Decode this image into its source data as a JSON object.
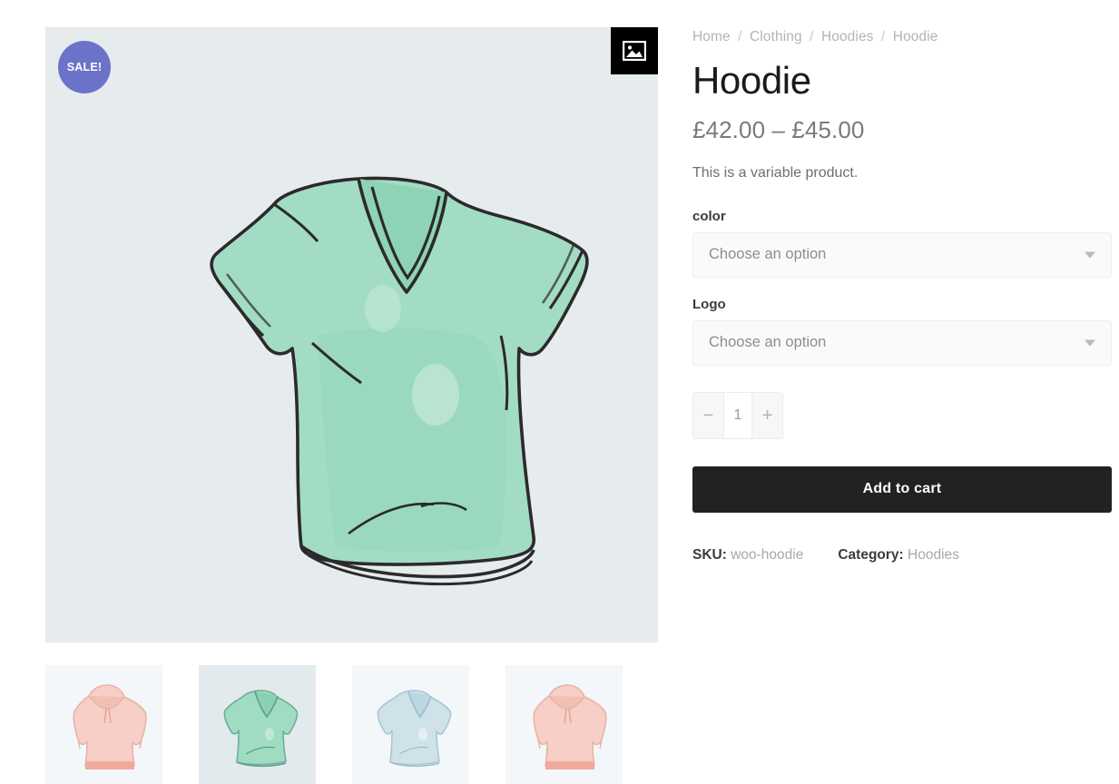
{
  "gallery": {
    "sale_badge": "SALE!",
    "zoom_icon": "image-placeholder-icon",
    "main_image_alt": "Mint green hand-drawn v-neck t-shirt",
    "background_color": "#e6ebee",
    "thumbnails": [
      {
        "alt": "Pink hoodie",
        "garment": "hoodie",
        "color": "#f7cfc6",
        "active": false
      },
      {
        "alt": "Green t-shirt",
        "garment": "tshirt",
        "color": "#9fdcc2",
        "active": true
      },
      {
        "alt": "Blue t-shirt",
        "garment": "tshirt",
        "color": "#cfe2ea",
        "active": false
      },
      {
        "alt": "Pink hoodie",
        "garment": "hoodie",
        "color": "#f7cfc6",
        "active": false
      }
    ]
  },
  "breadcrumb": {
    "separator": "/",
    "items": [
      "Home",
      "Clothing",
      "Hoodies",
      "Hoodie"
    ]
  },
  "product": {
    "title": "Hoodie",
    "price_min": "£42.00",
    "price_range_separator": "–",
    "price_max": "£45.00",
    "price_display": "£42.00 – £45.00",
    "short_description": "This is a variable product."
  },
  "variations": [
    {
      "label": "color",
      "selected": "Choose an option",
      "placeholder": "Choose an option",
      "caret_icon": "chevron-down-icon"
    },
    {
      "label": "Logo",
      "selected": "Choose an option",
      "placeholder": "Choose an option",
      "caret_icon": "chevron-down-icon"
    }
  ],
  "cart": {
    "decrement_label": "−",
    "quantity_value": "1",
    "increment_label": "+",
    "add_to_cart_label": "Add to cart"
  },
  "meta": {
    "sku_key": "SKU:",
    "sku_value": "woo-hoodie",
    "category_key": "Category:",
    "category_value": "Hoodies"
  },
  "colors": {
    "accent_badge": "#6b73c9",
    "button_dark": "#222222",
    "image_bg": "#e6ebee",
    "muted_text": "#a8a8a8"
  }
}
